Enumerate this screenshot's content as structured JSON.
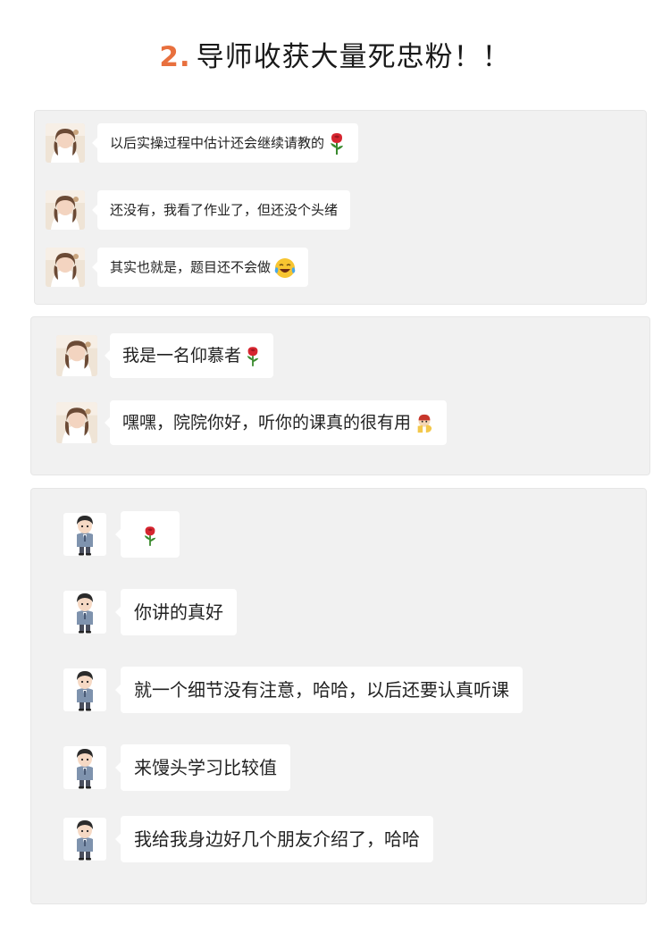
{
  "title": {
    "number": "2.",
    "text": "导师收获大量死忠粉！！"
  },
  "panel1": {
    "messages": [
      {
        "text": "以后实操过程中估计还会继续请教的",
        "emoji": "rose-emoji"
      },
      {
        "text": "还没有，我看了作业了，但还没个头绪",
        "emoji": ""
      },
      {
        "text": "其实也就是，题目还不会做",
        "emoji": "crying-laughing-emoji"
      }
    ]
  },
  "panel2": {
    "messages": [
      {
        "text": "我是一名仰慕者",
        "emoji": "rose-emoji"
      },
      {
        "text": "嘿嘿，院院你好，听你的课真的很有用",
        "emoji": "thumbs-up-emoji"
      }
    ]
  },
  "panel3": {
    "messages": [
      {
        "text": "",
        "emoji": "rose-emoji"
      },
      {
        "text": "你讲的真好",
        "emoji": ""
      },
      {
        "text": "就一个细节没有注意，哈哈，以后还要认真听课",
        "emoji": ""
      },
      {
        "text": "来馒头学习比较值",
        "emoji": ""
      },
      {
        "text": "我给我身边好几个朋友介绍了，哈哈",
        "emoji": ""
      }
    ]
  },
  "colors": {
    "accent": "#e8703e",
    "panel_bg": "#f1f1f1",
    "bubble_bg": "#ffffff"
  }
}
